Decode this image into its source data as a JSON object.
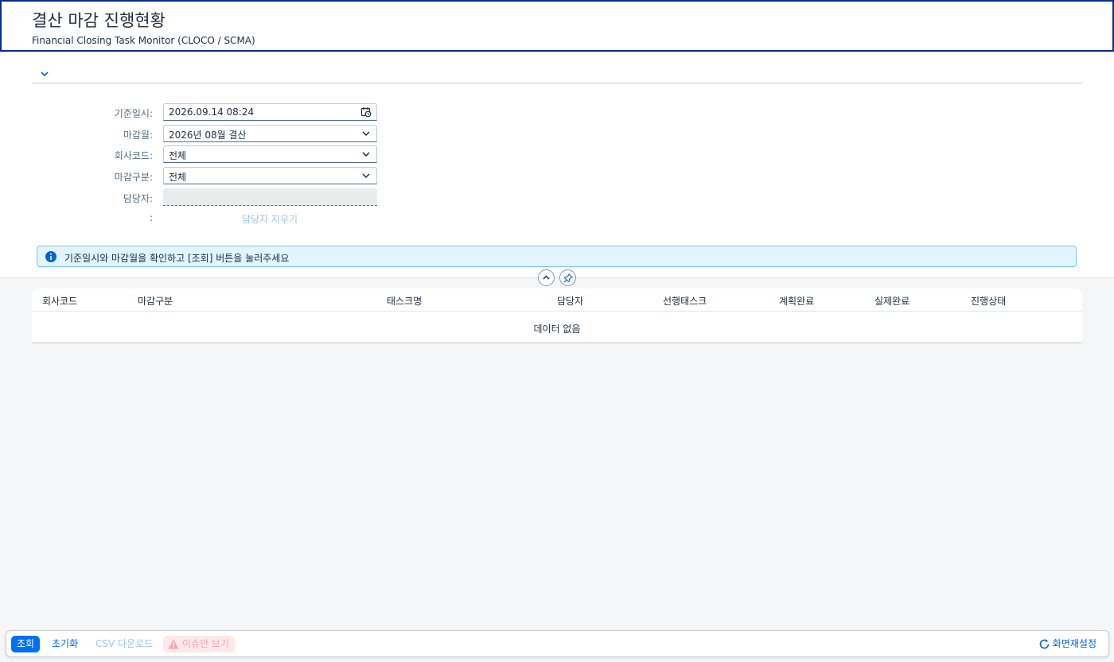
{
  "header": {
    "title": "결산 마감 진행현황",
    "subtitle": "Financial Closing Task Monitor (CLOCO / SCMA)"
  },
  "filters": {
    "fields": [
      {
        "label": "기준일시:",
        "value": "2026.09.14 08:24",
        "icon": "calendar-clock-icon"
      },
      {
        "label": "마감월:",
        "value": "2026년 08월 결산",
        "icon": "chevron-down-icon"
      },
      {
        "label": "회사코드:",
        "value": "전체",
        "icon": "chevron-down-icon"
      },
      {
        "label": "마감구분:",
        "value": "전체",
        "icon": "chevron-down-icon"
      },
      {
        "label": "담당자:",
        "value": "",
        "icon": ""
      }
    ],
    "clear_row_label": ":",
    "clear_link": "담당자 지우기"
  },
  "message": {
    "type": "info",
    "text": "기준일시와 마감월을 확인하고 [조회] 버튼을 눌러주세요"
  },
  "table": {
    "columns": [
      "회사코드",
      "마감구분",
      "태스크명",
      "담당자",
      "선행태스크",
      "계획완료",
      "실제완료",
      "진행상태"
    ],
    "rows": [],
    "empty_text": "데이터 없음"
  },
  "footer": {
    "search": "조회",
    "reset": "초기화",
    "csv": "CSV 다운로드",
    "issues_only": "이슈만 보기",
    "screen_reset": "화면재설정"
  },
  "colors": {
    "accent": "#0070f2",
    "header_border": "#0a2a8f",
    "info_bg": "#e1f4ff",
    "danger_bg": "#fde9ec"
  }
}
